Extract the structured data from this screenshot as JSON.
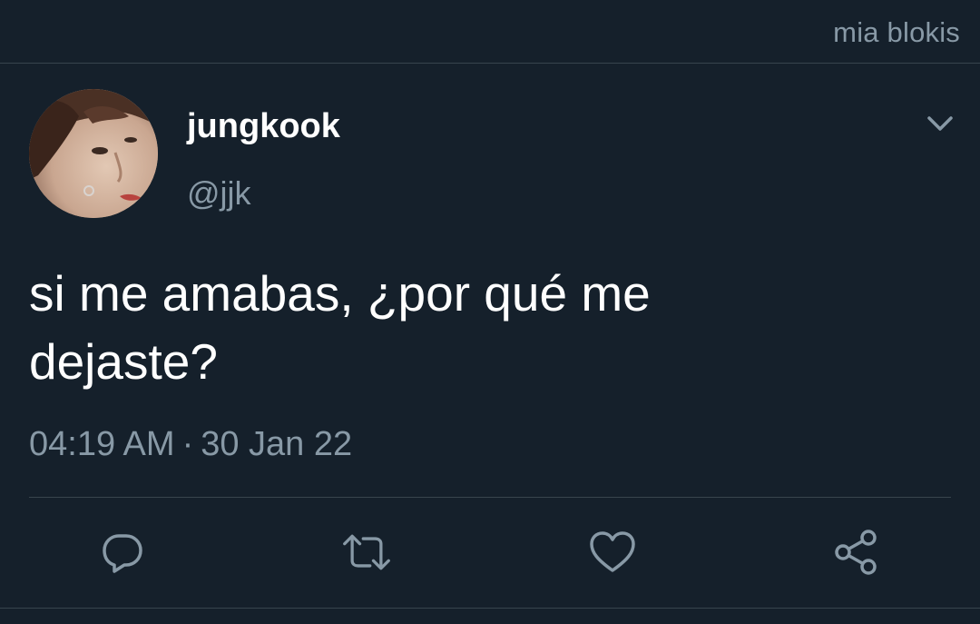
{
  "watermark": "mia blokis",
  "tweet": {
    "display_name": "jungkook",
    "handle": "@jjk",
    "text_line1": "si me amabas, ¿por qué me",
    "text_line2": "dejaste?",
    "time": "04:19 AM",
    "separator": "·",
    "date": "30 Jan 22"
  },
  "icons": {
    "options": "chevron-down-icon",
    "reply": "reply-icon",
    "retweet": "retweet-icon",
    "like": "heart-icon",
    "share": "share-icon"
  },
  "colors": {
    "background": "#15202b",
    "secondary_text": "#8899a6",
    "divider": "#38444d",
    "primary_text": "#ffffff"
  }
}
